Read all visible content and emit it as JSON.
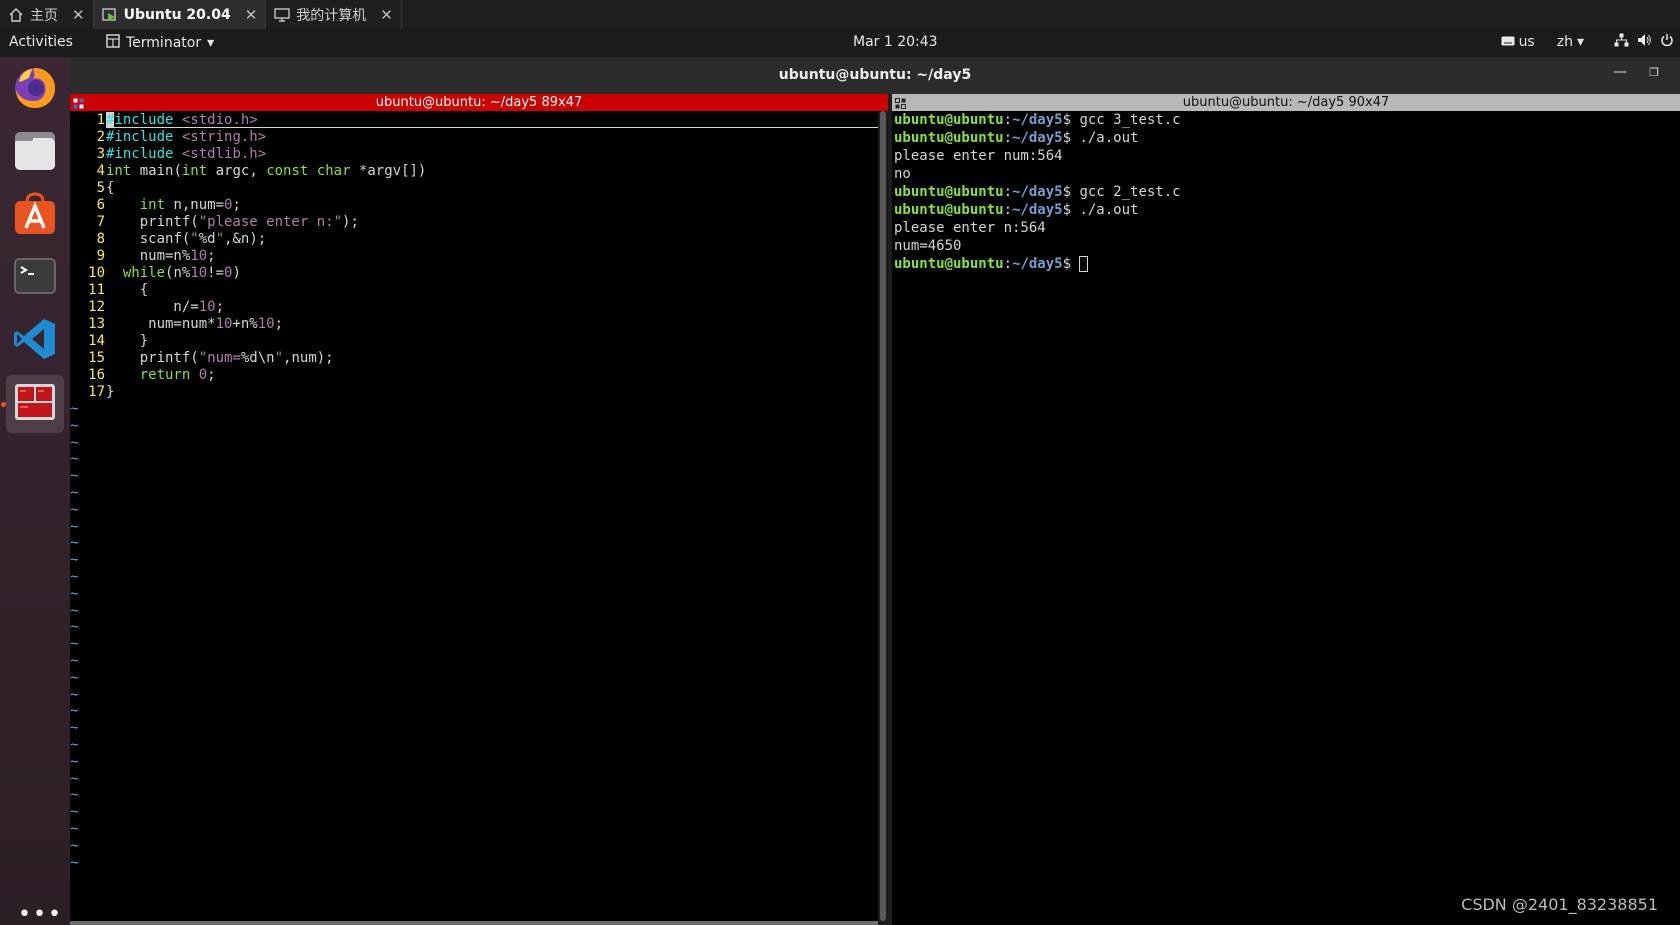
{
  "vm_tabs": [
    {
      "label": "主页",
      "icon": "home-icon"
    },
    {
      "label": "Ubuntu 20.04",
      "icon": "vm-icon",
      "active": true
    },
    {
      "label": "我的计算机",
      "icon": "monitor-icon"
    }
  ],
  "topbar": {
    "activities": "Activities",
    "app_menu": "Terminator",
    "clock": "Mar 1  20:43",
    "keyboard": "us",
    "input_method": "zh"
  },
  "dock": [
    "firefox-icon",
    "files-icon",
    "software-icon",
    "terminal-icon",
    "vscode-icon",
    "terminator-icon"
  ],
  "window": {
    "title": "ubuntu@ubuntu: ~/day5",
    "left_pane_title": "ubuntu@ubuntu: ~/day5 89x47",
    "right_pane_title": "ubuntu@ubuntu: ~/day5 90x47"
  },
  "vim": {
    "line_numbers": [
      "1",
      "2",
      "3",
      "4",
      "5",
      "6",
      "7",
      "8",
      "9",
      "10",
      "11",
      "12",
      "13",
      "14",
      "15",
      "16",
      "17"
    ],
    "tilde_count": 28
  },
  "shell": {
    "user_host": "ubuntu@ubuntu",
    "path": "~/day5",
    "lines": [
      {
        "type": "prompt",
        "cmd": "gcc 3_test.c"
      },
      {
        "type": "prompt",
        "cmd": "./a.out"
      },
      {
        "type": "output",
        "text": "please enter num:564"
      },
      {
        "type": "output",
        "text": "no"
      },
      {
        "type": "prompt",
        "cmd": "gcc 2_test.c"
      },
      {
        "type": "prompt",
        "cmd": "./a.out"
      },
      {
        "type": "output",
        "text": "please enter n:564"
      },
      {
        "type": "output",
        "text": "num=4650"
      },
      {
        "type": "prompt",
        "cmd": ""
      }
    ]
  },
  "watermark": "CSDN @2401_83238851"
}
